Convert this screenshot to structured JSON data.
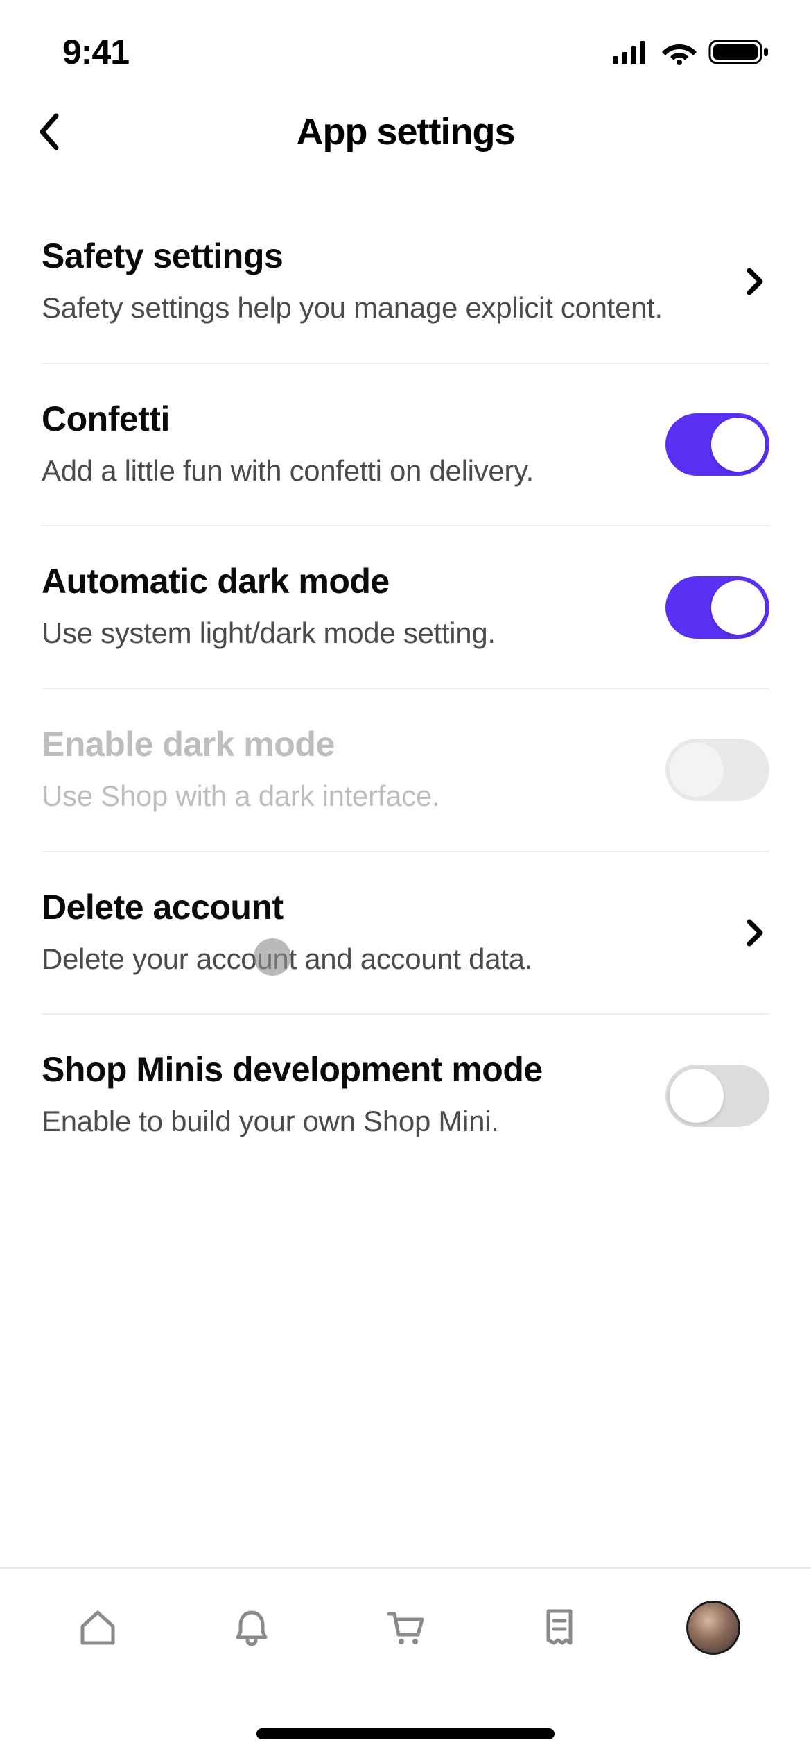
{
  "status": {
    "time": "9:41"
  },
  "header": {
    "title": "App settings"
  },
  "settings": {
    "safety": {
      "title": "Safety settings",
      "subtitle": "Safety settings help you manage explicit content."
    },
    "confetti": {
      "title": "Confetti",
      "subtitle": "Add a little fun with confetti on delivery.",
      "value": true
    },
    "auto_dark": {
      "title": "Automatic dark mode",
      "subtitle": "Use system light/dark mode setting.",
      "value": true
    },
    "enable_dark": {
      "title": "Enable dark mode",
      "subtitle": "Use Shop with a dark interface.",
      "value": false,
      "disabled": true
    },
    "delete_account": {
      "title": "Delete account",
      "subtitle": "Delete your account and account data."
    },
    "minis_dev": {
      "title": "Shop Minis development mode",
      "subtitle": "Enable to build your own Shop Mini.",
      "value": false
    }
  },
  "colors": {
    "accent": "#5a31f4",
    "text_primary": "#0a0a0a",
    "text_secondary": "#4b4b4b",
    "disabled": "#bdbdbd",
    "border": "#efefef",
    "toggle_off": "#dcdcdc"
  }
}
